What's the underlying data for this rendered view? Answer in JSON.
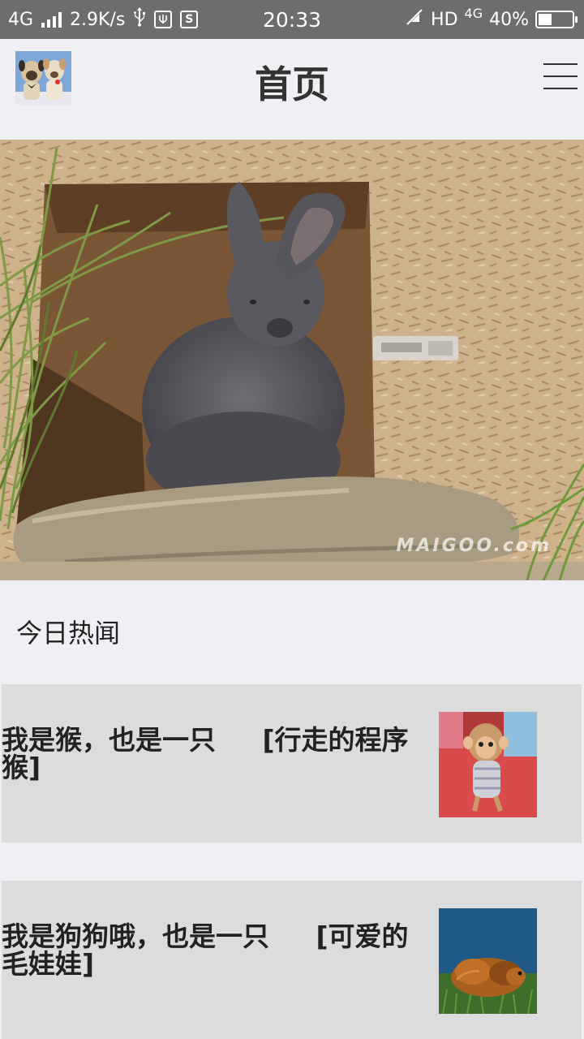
{
  "status_bar": {
    "network": "4G",
    "speed": "2.9K/s",
    "usb_icon": "usb-icon",
    "app_icon_1": "usb-debug-icon",
    "app_icon_2_label": "S",
    "time": "20:33",
    "hd": "HD",
    "network_right": "4G",
    "battery_percent": "40%",
    "battery_level": 0.4
  },
  "header": {
    "avatar_icon": "dogs-avatar-image",
    "title": "首页",
    "menu_icon": "hamburger-menu-icon"
  },
  "hero": {
    "image": "rabbit-photo",
    "watermark": "MAIGOO.com"
  },
  "section": {
    "title": "今日热闻"
  },
  "news": [
    {
      "text": "我是猴，也是一只     [行走的程序猴]",
      "thumb": "monkey-photo"
    },
    {
      "text": "我是狗狗哦，也是一只     [可爱的毛娃娃]",
      "thumb": "guinea-pig-photo"
    }
  ],
  "colors": {
    "status_bar": "#6d6d6d",
    "page_bg": "#efeff4",
    "card_bg": "#dcdcdc",
    "title_text": "#333333"
  }
}
